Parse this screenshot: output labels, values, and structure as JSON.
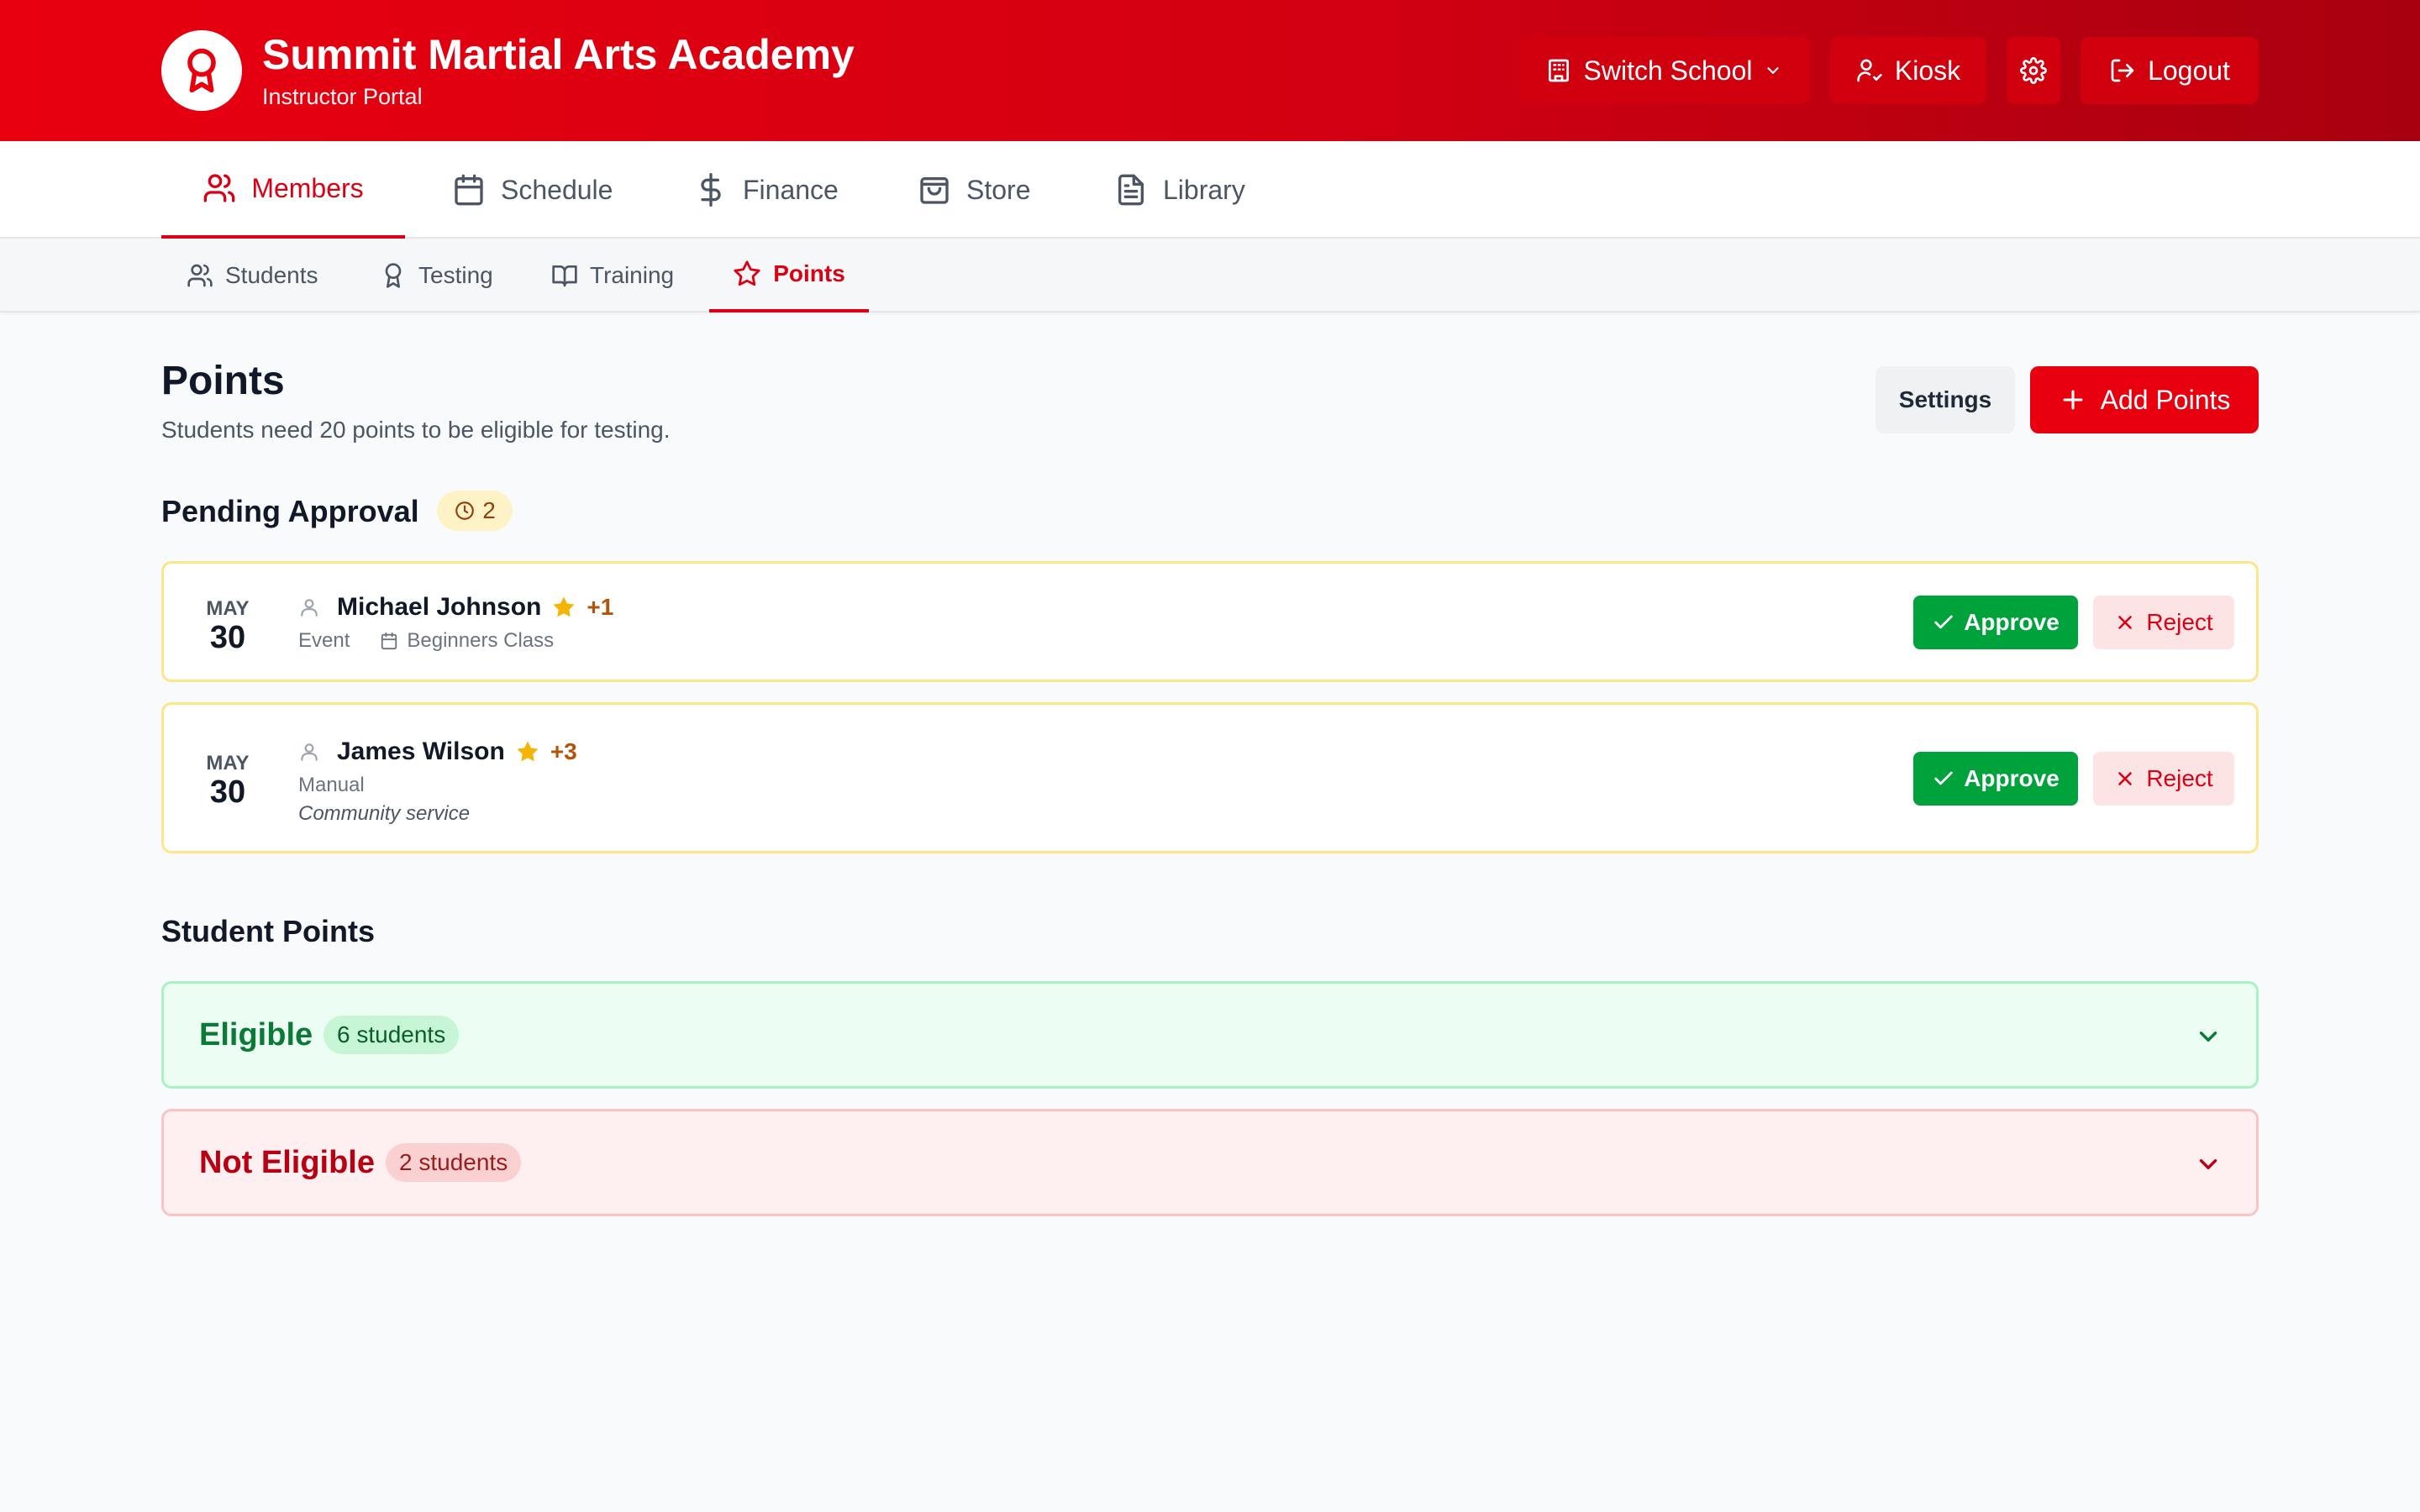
{
  "colors": {
    "brand": "#e8000f",
    "approve": "#00a23c",
    "pending_border": "#fde68a",
    "eligible": "#0b7a36",
    "not_eligible": "#b80012"
  },
  "header": {
    "title": "Summit Martial Arts Academy",
    "subtitle": "Instructor Portal",
    "logo_icon": "award-icon",
    "switch_school": "Switch School",
    "kiosk": "Kiosk",
    "logout": "Logout"
  },
  "nav": {
    "tabs": [
      {
        "label": "Members",
        "icon": "users-icon",
        "active": true
      },
      {
        "label": "Schedule",
        "icon": "calendar-icon"
      },
      {
        "label": "Finance",
        "icon": "dollar-icon"
      },
      {
        "label": "Store",
        "icon": "shopping-bag-icon"
      },
      {
        "label": "Library",
        "icon": "document-icon"
      }
    ]
  },
  "subnav": {
    "tabs": [
      {
        "label": "Students",
        "icon": "users-icon"
      },
      {
        "label": "Testing",
        "icon": "award-icon"
      },
      {
        "label": "Training",
        "icon": "book-icon"
      },
      {
        "label": "Points",
        "icon": "star-icon",
        "active": true
      }
    ]
  },
  "page": {
    "title": "Points",
    "subtitle": "Students need 20 points to be eligible for testing.",
    "settings_label": "Settings",
    "add_label": "Add Points"
  },
  "pending": {
    "title": "Pending Approval",
    "count": "2",
    "items": [
      {
        "month": "MAY",
        "day": "30",
        "name": "Michael Johnson",
        "points": "+1",
        "type": "Event",
        "event": "Beginners Class",
        "note": ""
      },
      {
        "month": "MAY",
        "day": "30",
        "name": "James Wilson",
        "points": "+3",
        "type": "Manual",
        "event": "",
        "note": "Community service"
      }
    ],
    "approve_label": "Approve",
    "reject_label": "Reject"
  },
  "student_points": {
    "title": "Student Points",
    "groups": [
      {
        "label": "Eligible",
        "count": "6 students"
      },
      {
        "label": "Not Eligible",
        "count": "2 students"
      }
    ]
  }
}
